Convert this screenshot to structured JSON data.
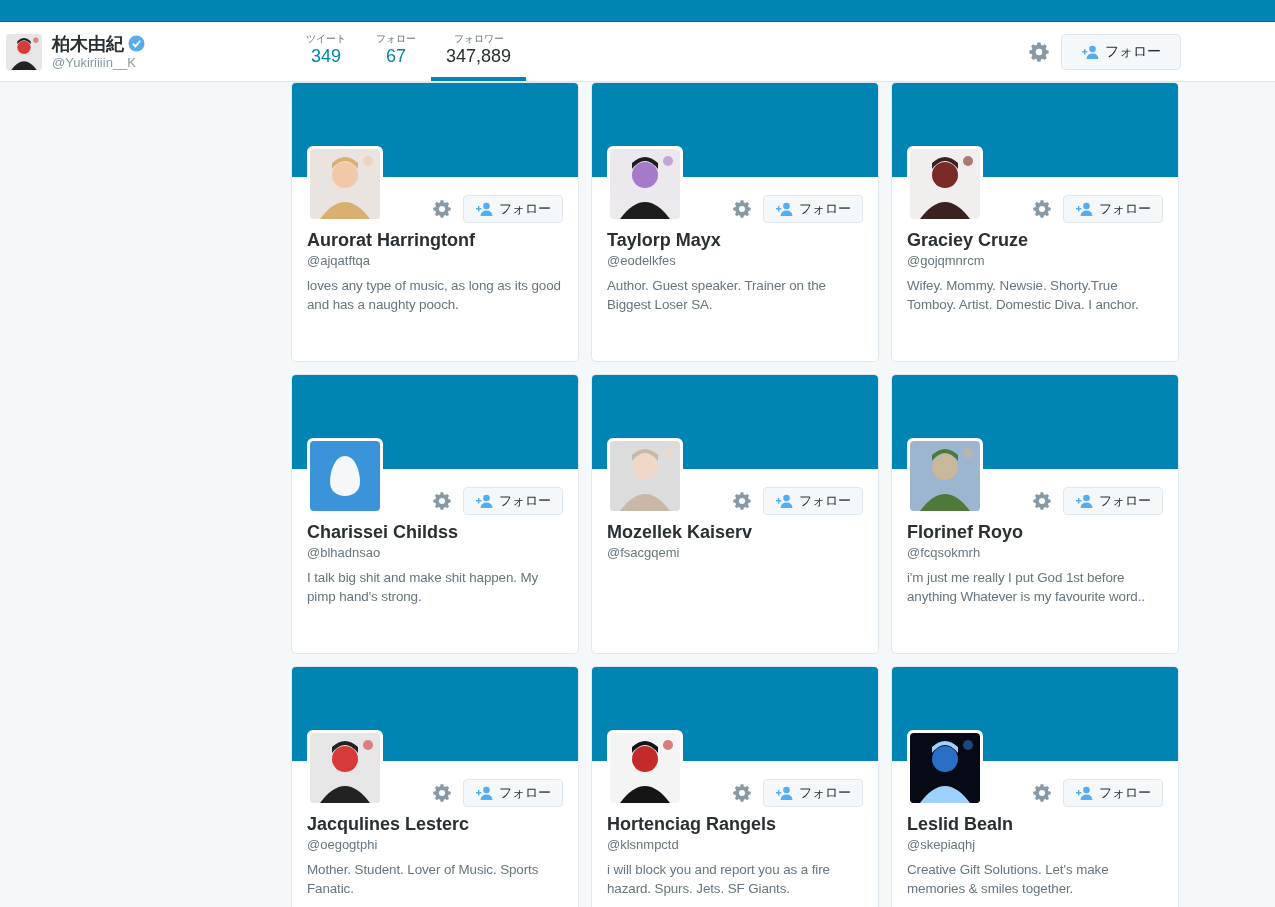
{
  "profile": {
    "name": "柏木由紀",
    "handle": "@Yukiriiiin__K",
    "verified": true
  },
  "stats": [
    {
      "label": "ツイート",
      "value": "349",
      "selected": false
    },
    {
      "label": "フォロー",
      "value": "67",
      "selected": false
    },
    {
      "label": "フォロワー",
      "value": "347,889",
      "selected": true
    }
  ],
  "follow_button": "フォロー",
  "cards": [
    {
      "name": "Aurorat Harringtonf",
      "handle": "@ajqatftqa",
      "bio": "loves any type of music, as long as its good and has a naughty pooch.",
      "follow_button": "フォロー"
    },
    {
      "name": "Taylorp Mayx",
      "handle": "@eodelkfes",
      "bio": "Author. Guest speaker. Trainer on the Biggest Loser SA.",
      "follow_button": "フォロー"
    },
    {
      "name": "Graciey Cruze",
      "handle": "@gojqmnrcm",
      "bio": "Wifey. Mommy. Newsie. Shorty.True Tomboy. Artist. Domestic Diva. I anchor.",
      "follow_button": "フォロー"
    },
    {
      "name": "Charissei Childss",
      "handle": "@blhadnsao",
      "bio": "I talk big shit and make shit happen. My pimp hand's strong.",
      "avatar": {
        "kind": "egg"
      },
      "follow_button": "フォロー"
    },
    {
      "name": "Mozellek Kaiserv",
      "handle": "@fsacgqemi",
      "follow_button": "フォロー"
    },
    {
      "name": "Florinef Royo",
      "handle": "@fcqsokmrh",
      "bio": "i'm just me really I put God 1st before anything Whatever is my favourite word..",
      "follow_button": "フォロー"
    },
    {
      "name": "Jacqulines Lesterc",
      "handle": "@oegogtphi",
      "bio": "Mother. Student. Lover of Music. Sports Fanatic.",
      "follow_button": "フォロー"
    },
    {
      "name": "Hortenciag Rangels",
      "handle": "@klsnmpctd",
      "bio": "i will block you and report you as a fire hazard. Spurs. Jets. SF Giants.",
      "follow_button": "フォロー"
    },
    {
      "name": "Leslid Bealn",
      "handle": "@skepiaqhj",
      "bio": "Creative Gift Solutions. Let's make memories & smiles together.",
      "follow_button": "フォロー"
    }
  ]
}
